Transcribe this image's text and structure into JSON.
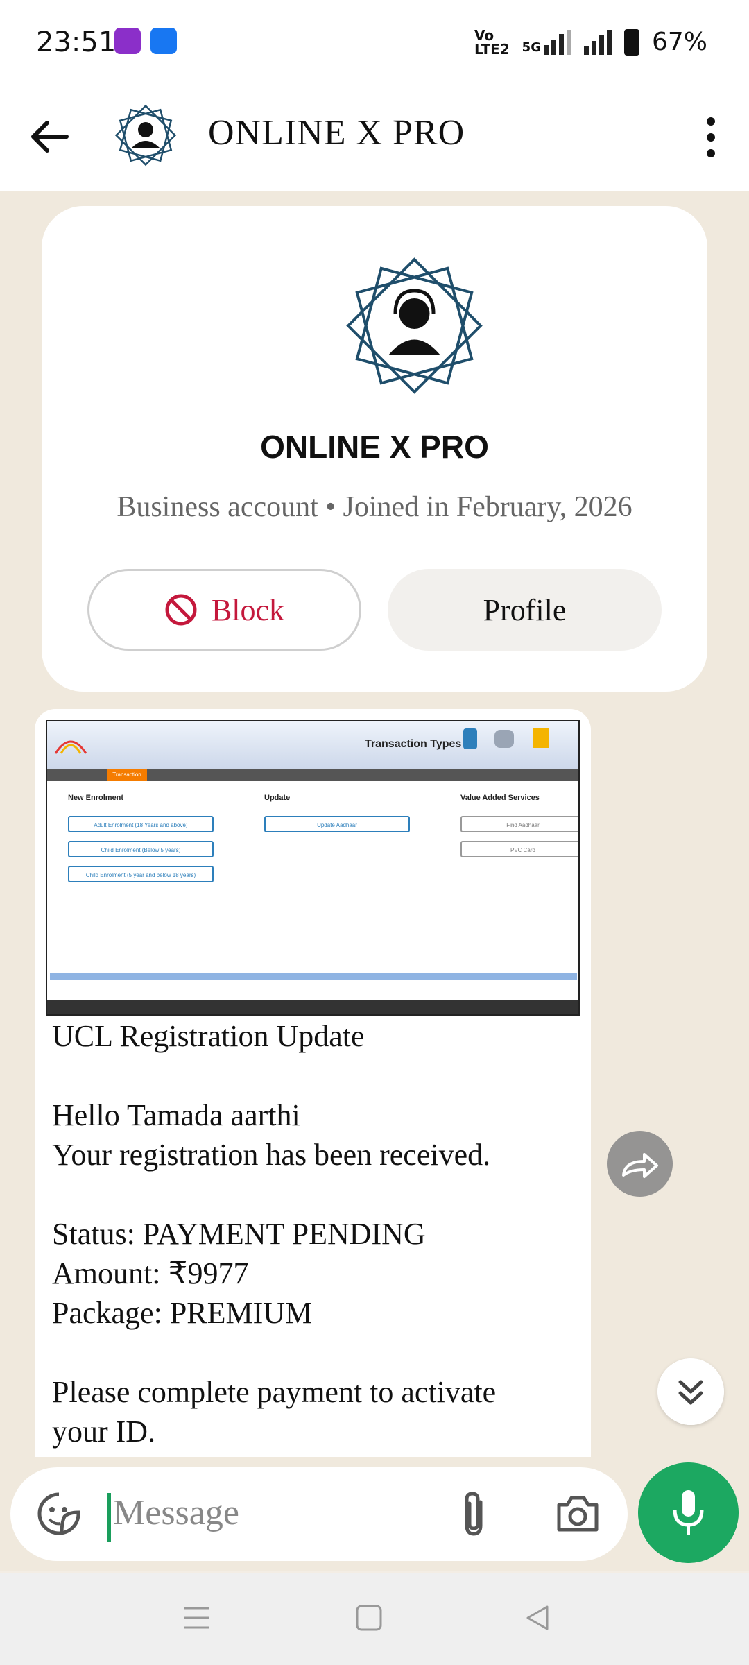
{
  "status_bar": {
    "time": "23:51",
    "network_label_top": "Vo",
    "network_label_bottom": "LTE2",
    "network_type": "5G",
    "battery_percent": "67%"
  },
  "header": {
    "title": "ONLINE X PRO"
  },
  "profile_card": {
    "name": "ONLINE X PRO",
    "subtitle": "Business account • Joined in February, 2026",
    "block_label": "Block",
    "profile_label": "Profile"
  },
  "message": {
    "screenshot": {
      "window_title": "Transaction Types",
      "tab_label": "Transaction Type",
      "col1_header": "New Enrolment",
      "col2_header": "Update",
      "col3_header": "Value Added Services",
      "btn_adult": "Adult Enrolment (18 Years and above)",
      "btn_child5": "Child Enrolment (Below 5 years)",
      "btn_child5_18": "Child Enrolment (5 year and below 18 years)",
      "btn_update": "Update Aadhaar",
      "btn_find": "Find Aadhaar",
      "btn_pvc": "PVC Card"
    },
    "text": "UCL Registration Update\n\nHello Tamada aarthi\nYour registration has been received.\n\nStatus: PAYMENT PENDING\nAmount: ₹9977\nPackage: PREMIUM\n\nPlease complete payment to activate\nyour ID."
  },
  "composer": {
    "placeholder": "Message"
  },
  "colors": {
    "accent_green": "#1ca861",
    "block_red": "#c4183c",
    "logo_blue": "#1f4e6b"
  }
}
